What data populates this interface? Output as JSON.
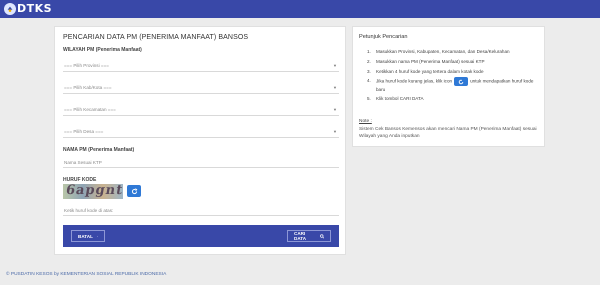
{
  "header": {
    "logo_text": "DTKS"
  },
  "form": {
    "title": "PENCARIAN DATA PM (PENERIMA MANFAAT) BANSOS",
    "wilayah_label": "WILAYAH PM (Penerima Manfaat)",
    "selects": [
      {
        "value": "=== Pilih Provinsi ==="
      },
      {
        "value": "=== Pilih Kab/Kota ==="
      },
      {
        "value": "=== Pilih Kecamatan ==="
      },
      {
        "value": "=== Pilih Desa ==="
      }
    ],
    "nama_label": "NAMA PM (Penerima Manfaat)",
    "nama_placeholder": "Nama Sesuai KTP",
    "captcha_label": "HURUF KODE",
    "captcha_text": "6apgnt",
    "captcha_placeholder": "Ketik huruf kode di atas:",
    "batal_label": "BATAL",
    "cari_label": "CARI DATA"
  },
  "petunjuk": {
    "title": "Petunjuk Pencarian",
    "steps": [
      "Masukkan Provinsi, Kabupaten, Kecamatan, dan Desa/Kelurahan",
      "Masukkan nama PM (Penerima Manfaat) sesuai KTP",
      "Ketikkan 4 huruf kode yang tertera dalam kotak kode",
      "Jika huruf kode kurang jelas, klik icon",
      "untuk mendapatkan huruf kode baru",
      "Klik tombol CARI DATA"
    ],
    "note_title": "Note :",
    "note_body": "Sistem Cek Bansos Kemensos akan mencari Nama PM (Penerima Manfaat) sesuai Wilayah yang Anda inputkan"
  },
  "footer": {
    "copyright": "© PUSDATIN KESOS by KEMENTERIAN SOSIAL REPUBLIK INDONESIA"
  },
  "colors": {
    "primary": "#3948a8",
    "accent": "#2f79d6"
  }
}
